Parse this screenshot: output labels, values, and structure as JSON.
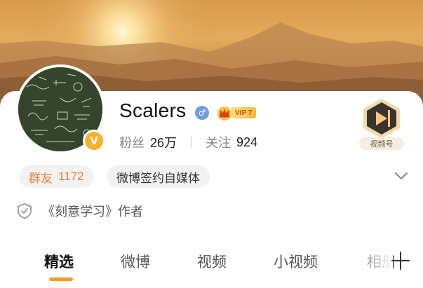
{
  "profile": {
    "name": "Scalers",
    "verify_badge": "V",
    "gender_symbol": "♂",
    "vip_label": "VIP 7",
    "followers_label": "粉丝",
    "followers_value": "26万",
    "following_label": "关注",
    "following_value": "924",
    "video_badge_label": "视频号"
  },
  "tags": {
    "group_label": "群友",
    "group_count": "1172",
    "media_label": "微博签约自媒体"
  },
  "intro": {
    "text": "《刻意学习》作者"
  },
  "tabs": [
    {
      "label": "精选",
      "active": true
    },
    {
      "label": "微博",
      "active": false
    },
    {
      "label": "视频",
      "active": false
    },
    {
      "label": "小视频",
      "active": false
    },
    {
      "label": "相册",
      "active": false
    }
  ],
  "colors": {
    "accent_orange": "#f49b26",
    "group_tag_text": "#f07d35",
    "verify_badge": "#f6b12d",
    "gender_blue": "#6f9fda"
  },
  "icons": {
    "gender": "male-icon",
    "vip": "crown-icon",
    "video": "video-channel-icon",
    "expand": "chevron-down-icon",
    "intro": "shield-check-icon",
    "add": "plus-icon"
  }
}
